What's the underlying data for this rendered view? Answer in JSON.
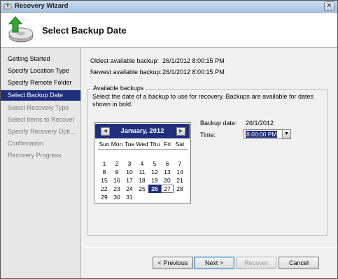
{
  "window": {
    "title": "Recovery Wizard",
    "close_glyph": "✕"
  },
  "header": {
    "title": "Select Backup Date",
    "icon": "backup-restore-icon"
  },
  "sidebar": {
    "items": [
      {
        "label": "Getting Started",
        "state": "normal"
      },
      {
        "label": "Specify Location Type",
        "state": "normal"
      },
      {
        "label": "Specify Remote Folder",
        "state": "normal"
      },
      {
        "label": "Select Backup Date",
        "state": "active"
      },
      {
        "label": "Select Recovery Type",
        "state": "disabled"
      },
      {
        "label": "Select Items to Recover",
        "state": "disabled"
      },
      {
        "label": "Specify Recovery Opti...",
        "state": "disabled"
      },
      {
        "label": "Confirmation",
        "state": "disabled"
      },
      {
        "label": "Recovery Progress",
        "state": "disabled"
      }
    ]
  },
  "main": {
    "oldest_label": "Oldest available backup:",
    "oldest_value": "26/1/2012 8:00:15 PM",
    "newest_label": "Newest available backup:",
    "newest_value": "26/1/2012 8:00:15 PM",
    "group_title": "Available backups",
    "group_desc": "Select the date of a backup to use for recovery. Backups are available for dates shown in bold.",
    "backup_date_label": "Backup date:",
    "backup_date_value": "26/1/2012",
    "time_label": "Time:",
    "time_value": "8:00:00 PM"
  },
  "calendar": {
    "title": "January, 2012",
    "prev_glyph": "◀",
    "next_glyph": "▶",
    "days_of_week": [
      "Sun",
      "Mon",
      "Tue",
      "Wed",
      "Thu",
      "Fri",
      "Sat"
    ],
    "weeks": [
      [
        "",
        "",
        "",
        "",
        "",
        "",
        ""
      ],
      [
        "1",
        "2",
        "3",
        "4",
        "5",
        "6",
        "7"
      ],
      [
        "8",
        "9",
        "10",
        "11",
        "12",
        "13",
        "14"
      ],
      [
        "15",
        "16",
        "17",
        "18",
        "19",
        "20",
        "21"
      ],
      [
        "22",
        "23",
        "24",
        "25",
        "26",
        "27",
        "28"
      ],
      [
        "29",
        "30",
        "31",
        "",
        "",
        "",
        ""
      ]
    ],
    "selected_day": "26",
    "today_day": "27"
  },
  "buttons": {
    "previous": "< Previous",
    "next": "Next >",
    "recover": "Recover",
    "cancel": "Cancel"
  },
  "colors": {
    "accent": "#1f2f7c",
    "window_bg": "#f0f0f0",
    "titlebar": "#b8cfe9"
  }
}
